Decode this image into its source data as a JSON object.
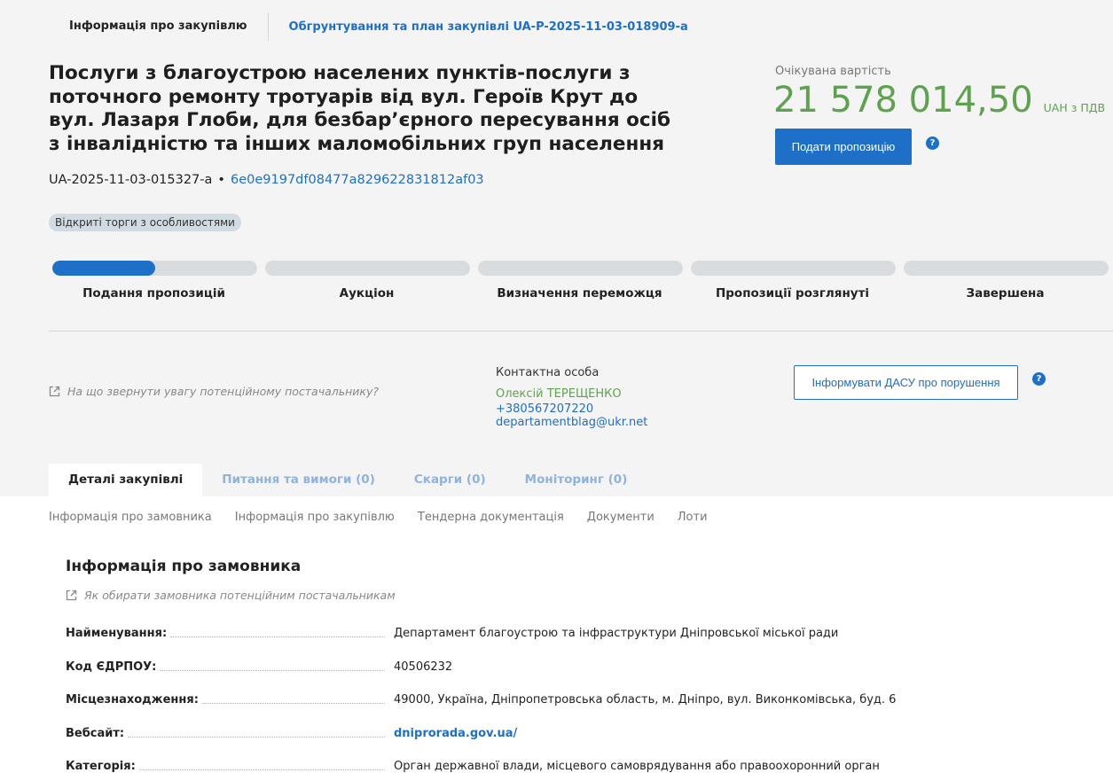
{
  "top_tabs": {
    "active": "Інформація про закупівлю",
    "plan_link": "Обгрунтування та план закупівлі UA-P-2025-11-03-018909-a"
  },
  "tender": {
    "title": "Послуги з благоустрою населених пунктів-послуги з поточного ремонту тротуарів від вул. Героїв Крут до вул. Лазаря Глоби, для безбар’єрного пересування осіб з інвалідністю та інших маломобільних груп населення",
    "id": "UA-2025-11-03-015327-a",
    "separator": "•",
    "hash": "6e0e9197df08477a829622831812af03",
    "procedure_badge": "Відкриті торги з особливостями"
  },
  "budget": {
    "label": "Очікувана вартість",
    "amount": "21 578 014,50",
    "currency": "UAH з ПДВ",
    "submit_button": "Подати пропозицію",
    "help_glyph": "?"
  },
  "stages": [
    {
      "label": "Подання пропозицій",
      "progress": 0.5
    },
    {
      "label": "Аукціон",
      "progress": 0
    },
    {
      "label": "Визначення переможця",
      "progress": 0
    },
    {
      "label": "Пропозиції розглянуті",
      "progress": 0
    },
    {
      "label": "Завершена",
      "progress": 0
    }
  ],
  "supplier_hint": "На що звернути увагу потенційному постачальнику?",
  "contact": {
    "title": "Контактна особа",
    "name": "Олексій ТЕРЕЩЕНКО",
    "phone": "+380567207220",
    "email": "departamentblag@ukr.net"
  },
  "report_button": "Інформувати ДАСУ про порушення",
  "tabs": [
    {
      "label": "Деталі закупівлі",
      "active": true
    },
    {
      "label": "Питання та вимоги (0)",
      "active": false
    },
    {
      "label": "Скарги (0)",
      "active": false
    },
    {
      "label": "Моніторинг (0)",
      "active": false
    }
  ],
  "subnav": [
    "Інформація про замовника",
    "Інформація про закупівлю",
    "Тендерна документація",
    "Документи",
    "Лоти"
  ],
  "customer": {
    "section_title": "Інформація про замовника",
    "hint": "Як обирати замовника потенційним постачальникам",
    "fields": [
      {
        "label": "Найменування:",
        "value": "Департамент благоустрою та інфраструктури Дніпровської міської ради"
      },
      {
        "label": "Код ЄДРПОУ:",
        "value": "40506232"
      },
      {
        "label": "Місцезнаходження:",
        "value": "49000, Україна, Дніпропетровська область, м. Дніпро, вул. Виконкомівська, буд. 6"
      },
      {
        "label": "Вебсайт:",
        "value": "dniprorada.gov.ua/"
      },
      {
        "label": "Категорія:",
        "value": "Орган державної влади, місцевого самоврядування або правоохоронний орган"
      }
    ]
  },
  "colors": {
    "primary": "#1e6fc7",
    "price_green": "#5ea24f",
    "track_gray": "#d9dcdf",
    "page_gray": "#f4f4f4",
    "badge_bg": "#d0dbe2"
  }
}
